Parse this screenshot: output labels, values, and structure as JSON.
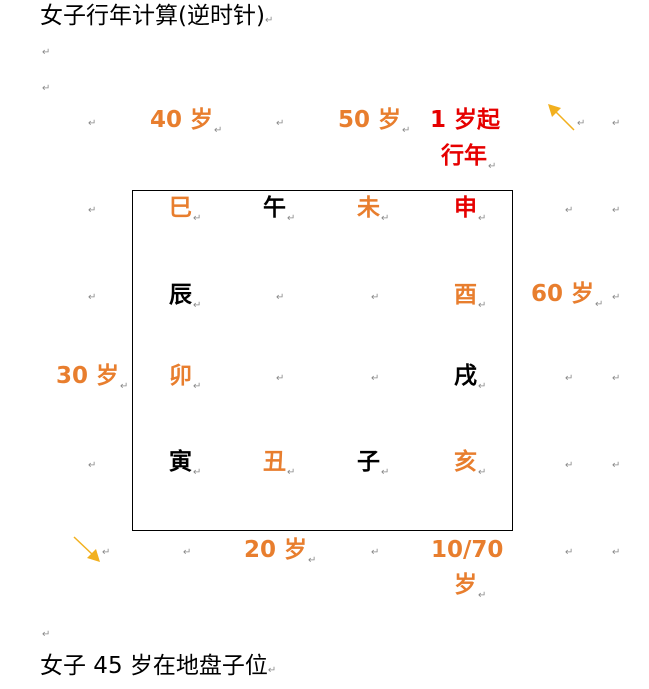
{
  "title": "女子行年计算(逆时针)",
  "footer": "女子 45 岁在地盘子位",
  "mark": "↵",
  "colors": {
    "orange": "#e87e2e",
    "red": "#e60000",
    "black": "#000000",
    "arrow": "#f2b01e"
  },
  "branches": {
    "si": "巳",
    "wu": "午",
    "wei": "未",
    "shen": "申",
    "chen": "辰",
    "you": "酉",
    "mao": "卯",
    "xu": "戌",
    "yin": "寅",
    "chou": "丑",
    "zi": "子",
    "hai": "亥"
  },
  "ages": {
    "age40": "40 岁",
    "age50": "50 岁",
    "age1_line1": "1 岁起",
    "age1_line2": "行年",
    "age60": "60 岁",
    "age30": "30 岁",
    "age20": "20 岁",
    "age1070_line1": "10/70",
    "age1070_line2": "岁"
  },
  "icons": {
    "top_right": "arrow-up-left-icon",
    "bottom_left": "arrow-down-right-icon"
  }
}
